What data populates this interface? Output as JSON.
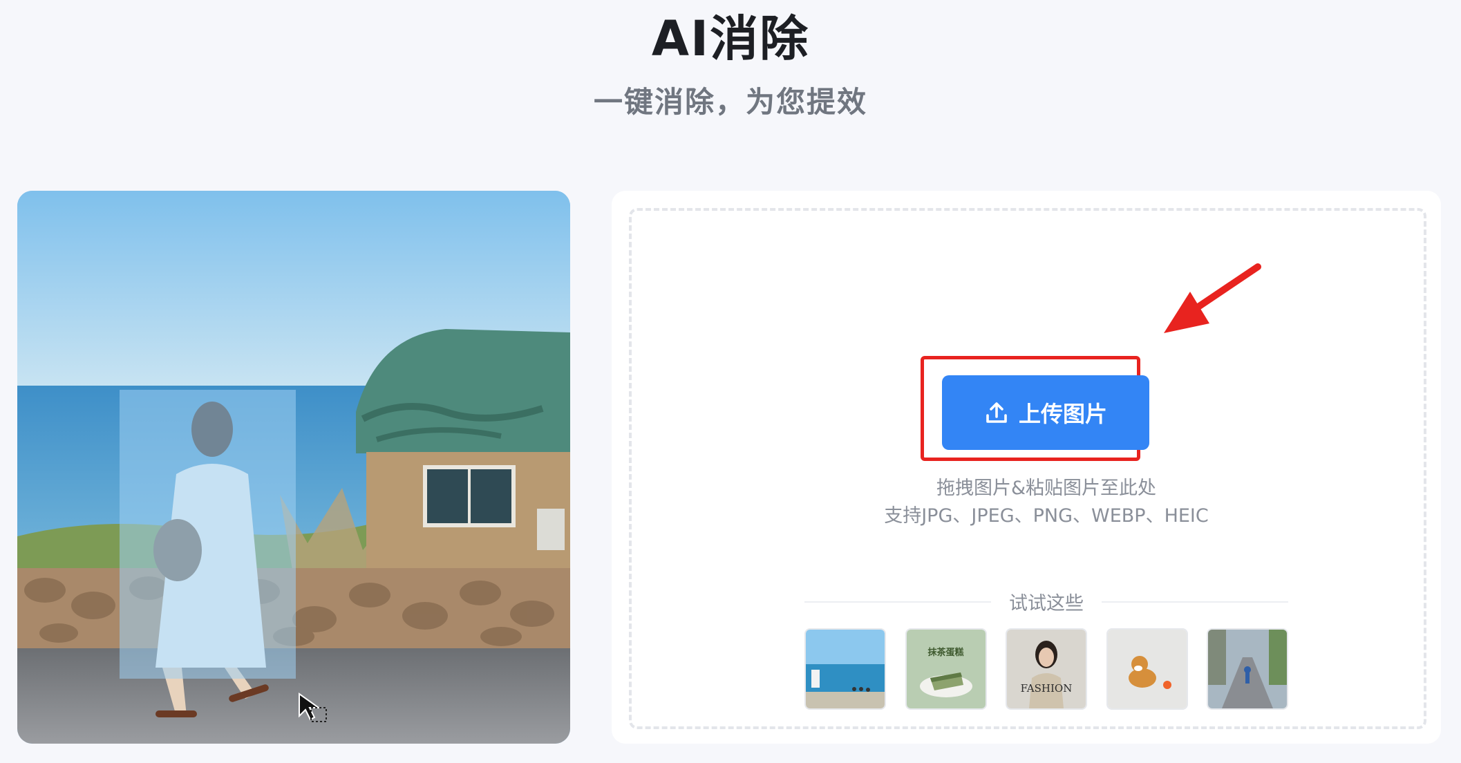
{
  "header": {
    "title": "AI消除",
    "subtitle": "一键消除，为您提效"
  },
  "upload": {
    "button_label": "上传图片",
    "hint_drag": "拖拽图片&粘贴图片至此处",
    "hint_formats": "支持JPG、JPEG、PNG、WEBP、HEIC"
  },
  "samples": {
    "label": "试试这些",
    "items": [
      {
        "name": "beach-scene",
        "text": ""
      },
      {
        "name": "matcha-cake",
        "text": "抹茶蛋糕"
      },
      {
        "name": "fashion-portrait",
        "text": "FASHION"
      },
      {
        "name": "dog-with-ball",
        "text": ""
      },
      {
        "name": "street-cyclist",
        "text": ""
      }
    ]
  },
  "colors": {
    "accent": "#3385f5",
    "annotation": "#e8231f",
    "background": "#f6f7fb"
  },
  "icons": {
    "upload": "upload-icon",
    "annotation_arrow": "arrow-icon",
    "cursor": "cursor-icon"
  }
}
